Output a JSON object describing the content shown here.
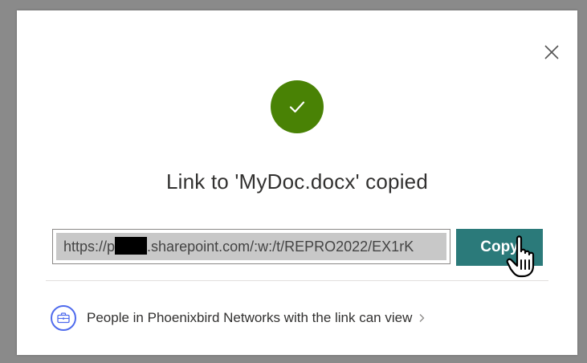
{
  "dialog": {
    "title": "Link to 'MyDoc.docx' copied",
    "link": {
      "prefix": "https://p",
      "suffix": ".sharepoint.com/:w:/t/REPRO2022/EX1rK"
    },
    "copy_label": "Copy",
    "permission_text": "People in Phoenixbird Networks with the link can view"
  },
  "icons": {
    "close": "close-icon",
    "success": "checkmark-icon",
    "people": "briefcase-icon",
    "chevron": "chevron-right-icon",
    "cursor": "hand-pointer-cursor-icon"
  },
  "colors": {
    "success_green": "#498205",
    "copy_button": "#2b7a7a",
    "people_icon_accent": "#4f6bed"
  }
}
